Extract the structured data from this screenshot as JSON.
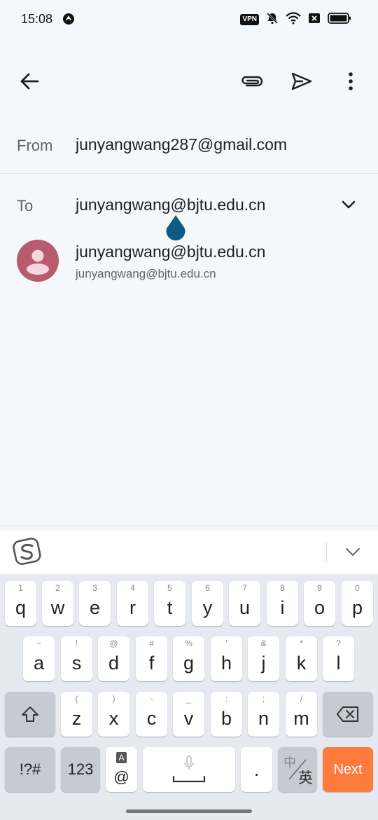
{
  "status_bar": {
    "time": "15:08",
    "vpn": "VPN",
    "icons": [
      "app-notification-icon",
      "vpn-icon",
      "mute-icon",
      "wifi-icon",
      "sim-off-icon",
      "battery-icon"
    ]
  },
  "app_bar": {
    "back_icon": "arrow-left-icon",
    "attach_icon": "paperclip-icon",
    "send_icon": "send-icon",
    "more_icon": "more-vert-icon"
  },
  "compose": {
    "from_label": "From",
    "from_value": "junyangwang287@gmail.com",
    "to_label": "To",
    "to_value": "junyangwang@bjtu.edu.cn"
  },
  "suggestion": {
    "name": "junyangwang@bjtu.edu.cn",
    "email": "junyangwang@bjtu.edu.cn"
  },
  "keyboard": {
    "row1": [
      {
        "main": "q",
        "sub": "1"
      },
      {
        "main": "w",
        "sub": "2"
      },
      {
        "main": "e",
        "sub": "3"
      },
      {
        "main": "r",
        "sub": "4"
      },
      {
        "main": "t",
        "sub": "5"
      },
      {
        "main": "y",
        "sub": "6"
      },
      {
        "main": "u",
        "sub": "7"
      },
      {
        "main": "i",
        "sub": "8"
      },
      {
        "main": "o",
        "sub": "9"
      },
      {
        "main": "p",
        "sub": "0"
      }
    ],
    "row2": [
      {
        "main": "a",
        "sub": "~"
      },
      {
        "main": "s",
        "sub": "!"
      },
      {
        "main": "d",
        "sub": "@"
      },
      {
        "main": "f",
        "sub": "#"
      },
      {
        "main": "g",
        "sub": "%"
      },
      {
        "main": "h",
        "sub": "'"
      },
      {
        "main": "j",
        "sub": "&"
      },
      {
        "main": "k",
        "sub": "*"
      },
      {
        "main": "l",
        "sub": "?"
      }
    ],
    "row3": [
      {
        "main": "z",
        "sub": "("
      },
      {
        "main": "x",
        "sub": ")"
      },
      {
        "main": "c",
        "sub": "-"
      },
      {
        "main": "v",
        "sub": "_"
      },
      {
        "main": "b",
        "sub": ":"
      },
      {
        "main": "n",
        "sub": ";"
      },
      {
        "main": "m",
        "sub": "/"
      }
    ],
    "symbols_label": "!?#",
    "numbers_label": "123",
    "at_label": "@",
    "at_sub": "A",
    "period_label": ".",
    "lang_top": "中",
    "lang_bottom": "英",
    "next_label": "Next"
  }
}
